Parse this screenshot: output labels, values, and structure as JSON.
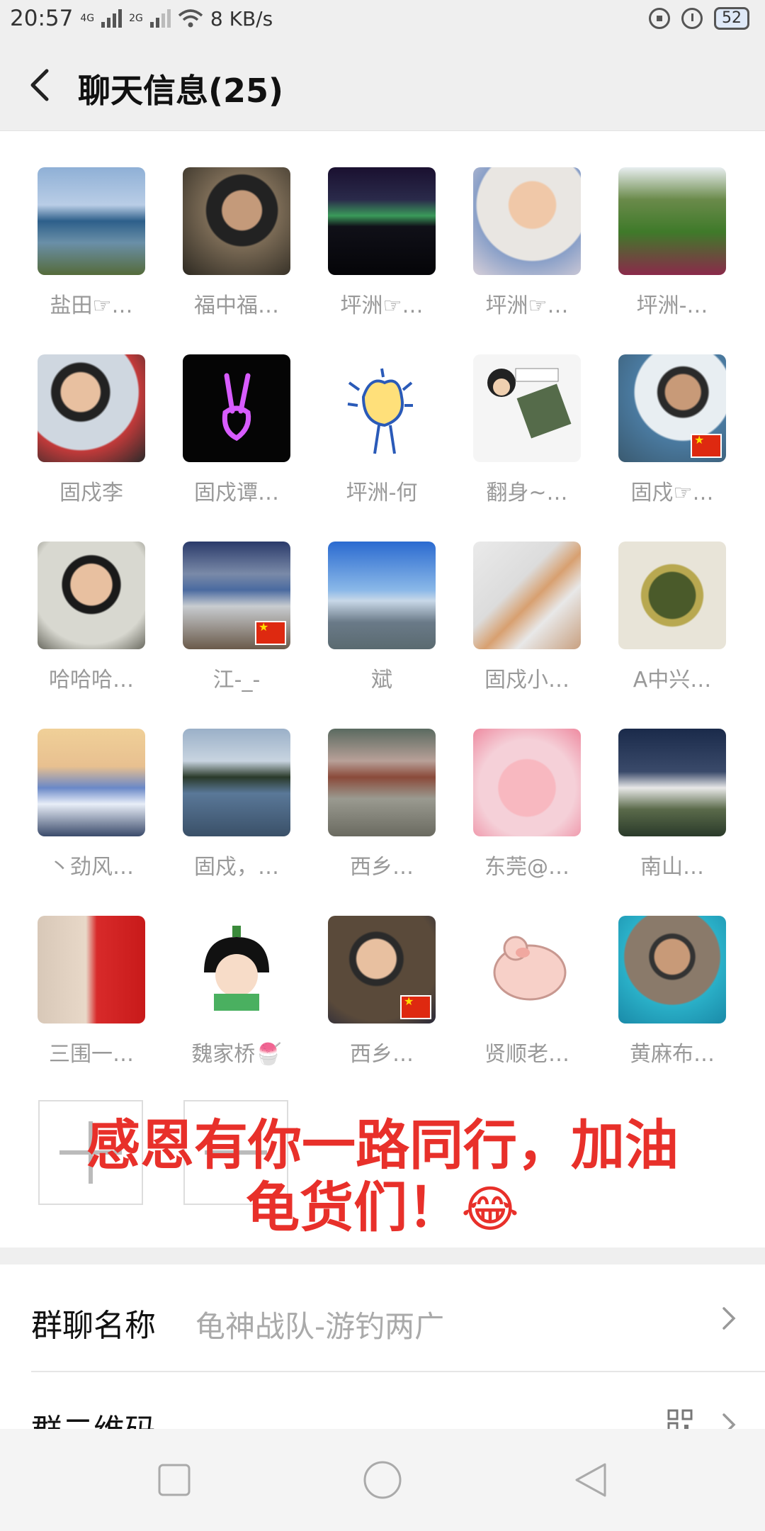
{
  "status": {
    "time": "20:57",
    "net1": "4G",
    "net2": "2G",
    "speed": "8 KB/s",
    "battery": "52"
  },
  "header": {
    "back_icon": "chevron-left-icon",
    "title": "聊天信息(25)"
  },
  "members": [
    {
      "name": "盐田☞…"
    },
    {
      "name": "福中福…"
    },
    {
      "name": "坪洲☞…"
    },
    {
      "name": "坪洲☞…"
    },
    {
      "name": "坪洲-…"
    },
    {
      "name": "固戍李"
    },
    {
      "name": "固戍谭…"
    },
    {
      "name": "坪洲-何"
    },
    {
      "name": "翻身~…"
    },
    {
      "name": "固戍☞…"
    },
    {
      "name": "哈哈哈…"
    },
    {
      "name": "江-_-"
    },
    {
      "name": "斌"
    },
    {
      "name": "固戍小…"
    },
    {
      "name": "A中兴…"
    },
    {
      "name": "丶劲风…"
    },
    {
      "name": "固戍，…"
    },
    {
      "name": "西乡…"
    },
    {
      "name": "东莞@…"
    },
    {
      "name": "南山…"
    },
    {
      "name": "三围一…"
    },
    {
      "name": "魏家桥🍧"
    },
    {
      "name": "西乡…"
    },
    {
      "name": "贤顺老…"
    },
    {
      "name": "黄麻布…"
    }
  ],
  "actions": {
    "add_icon": "plus-icon",
    "remove_icon": "minus-icon"
  },
  "overlay": {
    "line1": "感恩有你一路同行，加油",
    "line2": "龟货们！",
    "emoji": "😂"
  },
  "settings": {
    "group_name_label": "群聊名称",
    "group_name_value": "龟神战队-游钓两广",
    "qr_label": "群二维码"
  },
  "nav": {
    "square_icon": "recent-apps-icon",
    "circle_icon": "home-icon",
    "triangle_icon": "back-triangle-icon"
  }
}
